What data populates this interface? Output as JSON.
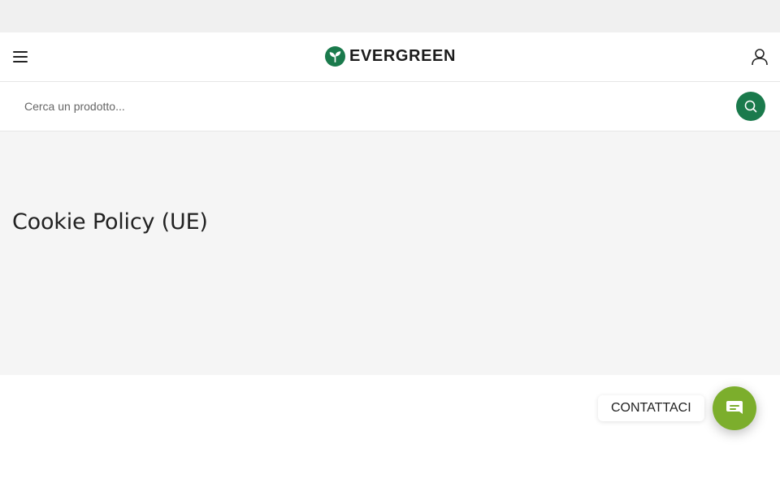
{
  "brand": {
    "name": "EVERGREEN",
    "primary_color": "#1a7a4c",
    "accent_color": "#7cae2c"
  },
  "header": {
    "menu_icon": "hamburger-icon",
    "account_icon": "user-icon"
  },
  "search": {
    "placeholder": "Cerca un prodotto...",
    "value": "",
    "icon": "search-icon"
  },
  "page": {
    "title": "Cookie Policy (UE)"
  },
  "contact": {
    "label": "CONTATTACI",
    "icon": "chat-bubble-icon"
  }
}
